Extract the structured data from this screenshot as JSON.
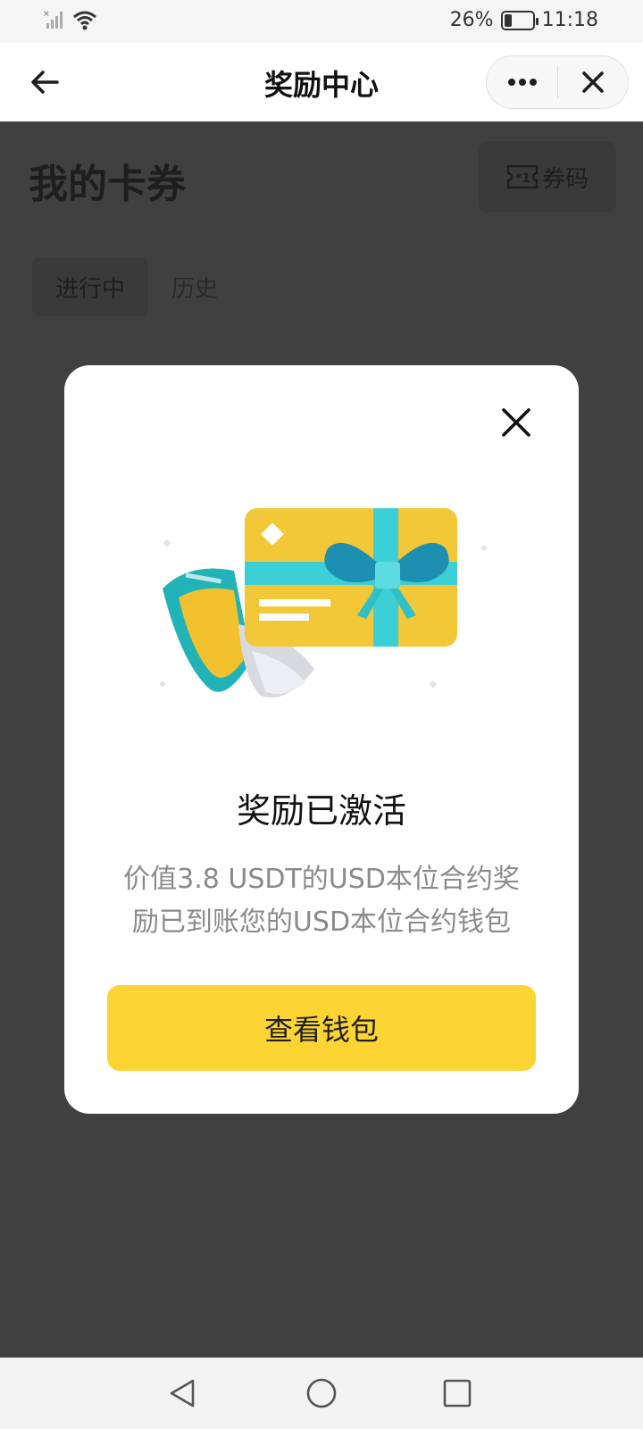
{
  "status_bar": {
    "battery_text": "26%",
    "battery_level": 0.26,
    "time": "11:18",
    "icons": [
      "signal-icon",
      "wifi-icon",
      "battery-icon"
    ]
  },
  "nav": {
    "title": "奖励中心",
    "icons": [
      "back-arrow-icon",
      "more-icon",
      "close-icon"
    ]
  },
  "page": {
    "title": "我的卡券",
    "voucher_code_label": "券码",
    "tabs": [
      {
        "label": "进行中",
        "active": true
      },
      {
        "label": "历史",
        "active": false
      }
    ]
  },
  "modal": {
    "title": "奖励已激活",
    "description": "价值3.8 USDT的USD本位合约奖励已到账您的USD本位合约钱包",
    "button_label": "查看钱包",
    "illustration": "gift-card-with-voucher",
    "colors": {
      "button": "#fcd535",
      "card": "#f2c12e",
      "ribbon": "#3ccfd6"
    }
  },
  "system_nav": {
    "icons": [
      "back-triangle-icon",
      "home-circle-icon",
      "recents-square-icon"
    ]
  }
}
